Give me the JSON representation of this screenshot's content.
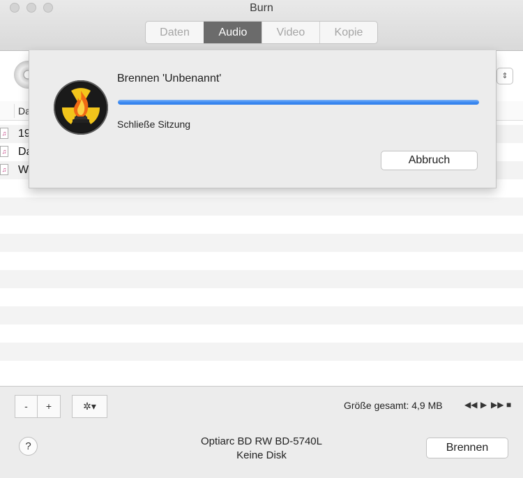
{
  "window": {
    "title": "Burn"
  },
  "tabs": [
    {
      "label": "Daten",
      "active": false
    },
    {
      "label": "Audio",
      "active": true
    },
    {
      "label": "Video",
      "active": false
    },
    {
      "label": "Kopie",
      "active": false
    }
  ],
  "file_list": {
    "column_header": "Da",
    "rows": [
      {
        "label": "19",
        "icon": "music-file-icon"
      },
      {
        "label": "Da",
        "icon": "music-file-icon"
      },
      {
        "label": "W",
        "icon": "music-file-icon"
      }
    ]
  },
  "toolbar_bottom": {
    "remove_label": "-",
    "add_label": "+",
    "action_icon": "gear-icon",
    "action_glyph": "✲▾",
    "total_size": "Größe gesamt: 4,9 MB",
    "transport": {
      "rewind": "◀◀",
      "play": "▶",
      "forward": "▶▶",
      "stop": "■"
    }
  },
  "footer": {
    "help_label": "?",
    "drive_name": "Optiarc BD RW BD-5740L",
    "disc_status": "Keine Disk",
    "burn_label": "Brennen"
  },
  "progress_sheet": {
    "title": "Brennen 'Unbenannt'",
    "status": "Schließe Sitzung",
    "progress": 1.0,
    "cancel_label": "Abbruch",
    "icon": "burn-radiation-flame-icon"
  },
  "colors": {
    "accent": "#3d8bf2",
    "active_tab": "#6b6b6b",
    "icon_yellow": "#f2c51b",
    "icon_black": "#1a1a1a",
    "flame": "#f06a14"
  }
}
